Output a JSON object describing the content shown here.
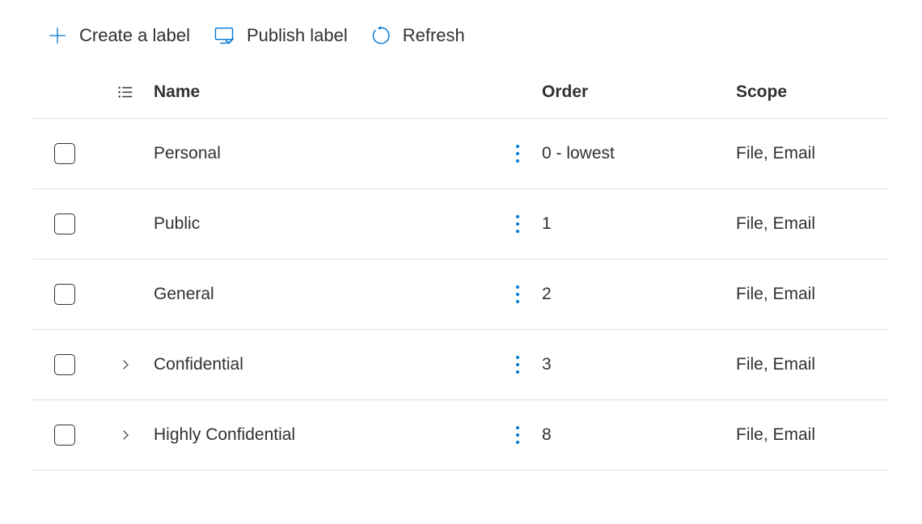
{
  "toolbar": {
    "create_label": "Create a label",
    "publish_label": "Publish label",
    "refresh_label": "Refresh"
  },
  "table": {
    "headers": {
      "name": "Name",
      "order": "Order",
      "scope": "Scope"
    },
    "rows": [
      {
        "name": "Personal",
        "order": "0 - lowest",
        "scope": "File, Email",
        "expandable": false
      },
      {
        "name": "Public",
        "order": "1",
        "scope": "File, Email",
        "expandable": false
      },
      {
        "name": "General",
        "order": "2",
        "scope": "File, Email",
        "expandable": false
      },
      {
        "name": "Confidential",
        "order": "3",
        "scope": "File, Email",
        "expandable": true
      },
      {
        "name": "Highly Confidential",
        "order": "8",
        "scope": "File, Email",
        "expandable": true
      }
    ]
  }
}
